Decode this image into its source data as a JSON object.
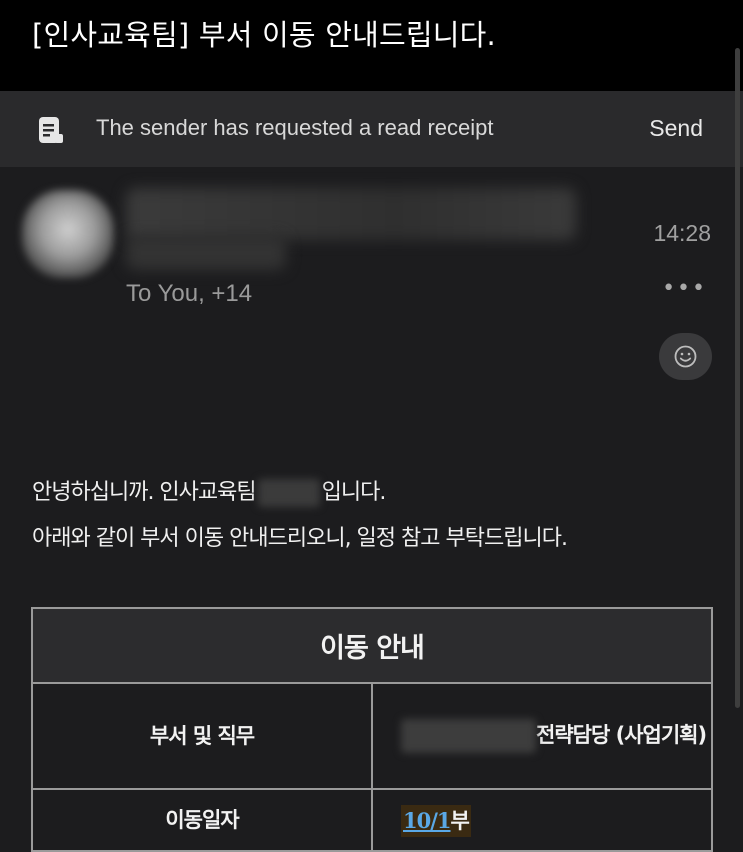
{
  "email": {
    "subject": "[인사교육팀] 부서 이동 안내드립니다.",
    "time": "14:28",
    "recipients": "To You, +14",
    "more_label": "•••"
  },
  "receipt_bar": {
    "text": "The sender has requested a read receipt",
    "send_label": "Send"
  },
  "body": {
    "line1_prefix": "안녕하십니까. 인사교육팀",
    "line1_suffix": "입니다.",
    "line2": "아래와 같이 부서 이동 안내드리오니, 일정 참고 부탁드립니다."
  },
  "table": {
    "header": "이동 안내",
    "rows": [
      {
        "label": "부서 및 직무",
        "value": "전략담당 (사업기획)"
      },
      {
        "label": "이동일자",
        "date": "10/1",
        "suffix": "부"
      }
    ]
  },
  "icons": {
    "receipt": "document-icon",
    "emoji": "smiley-icon"
  }
}
